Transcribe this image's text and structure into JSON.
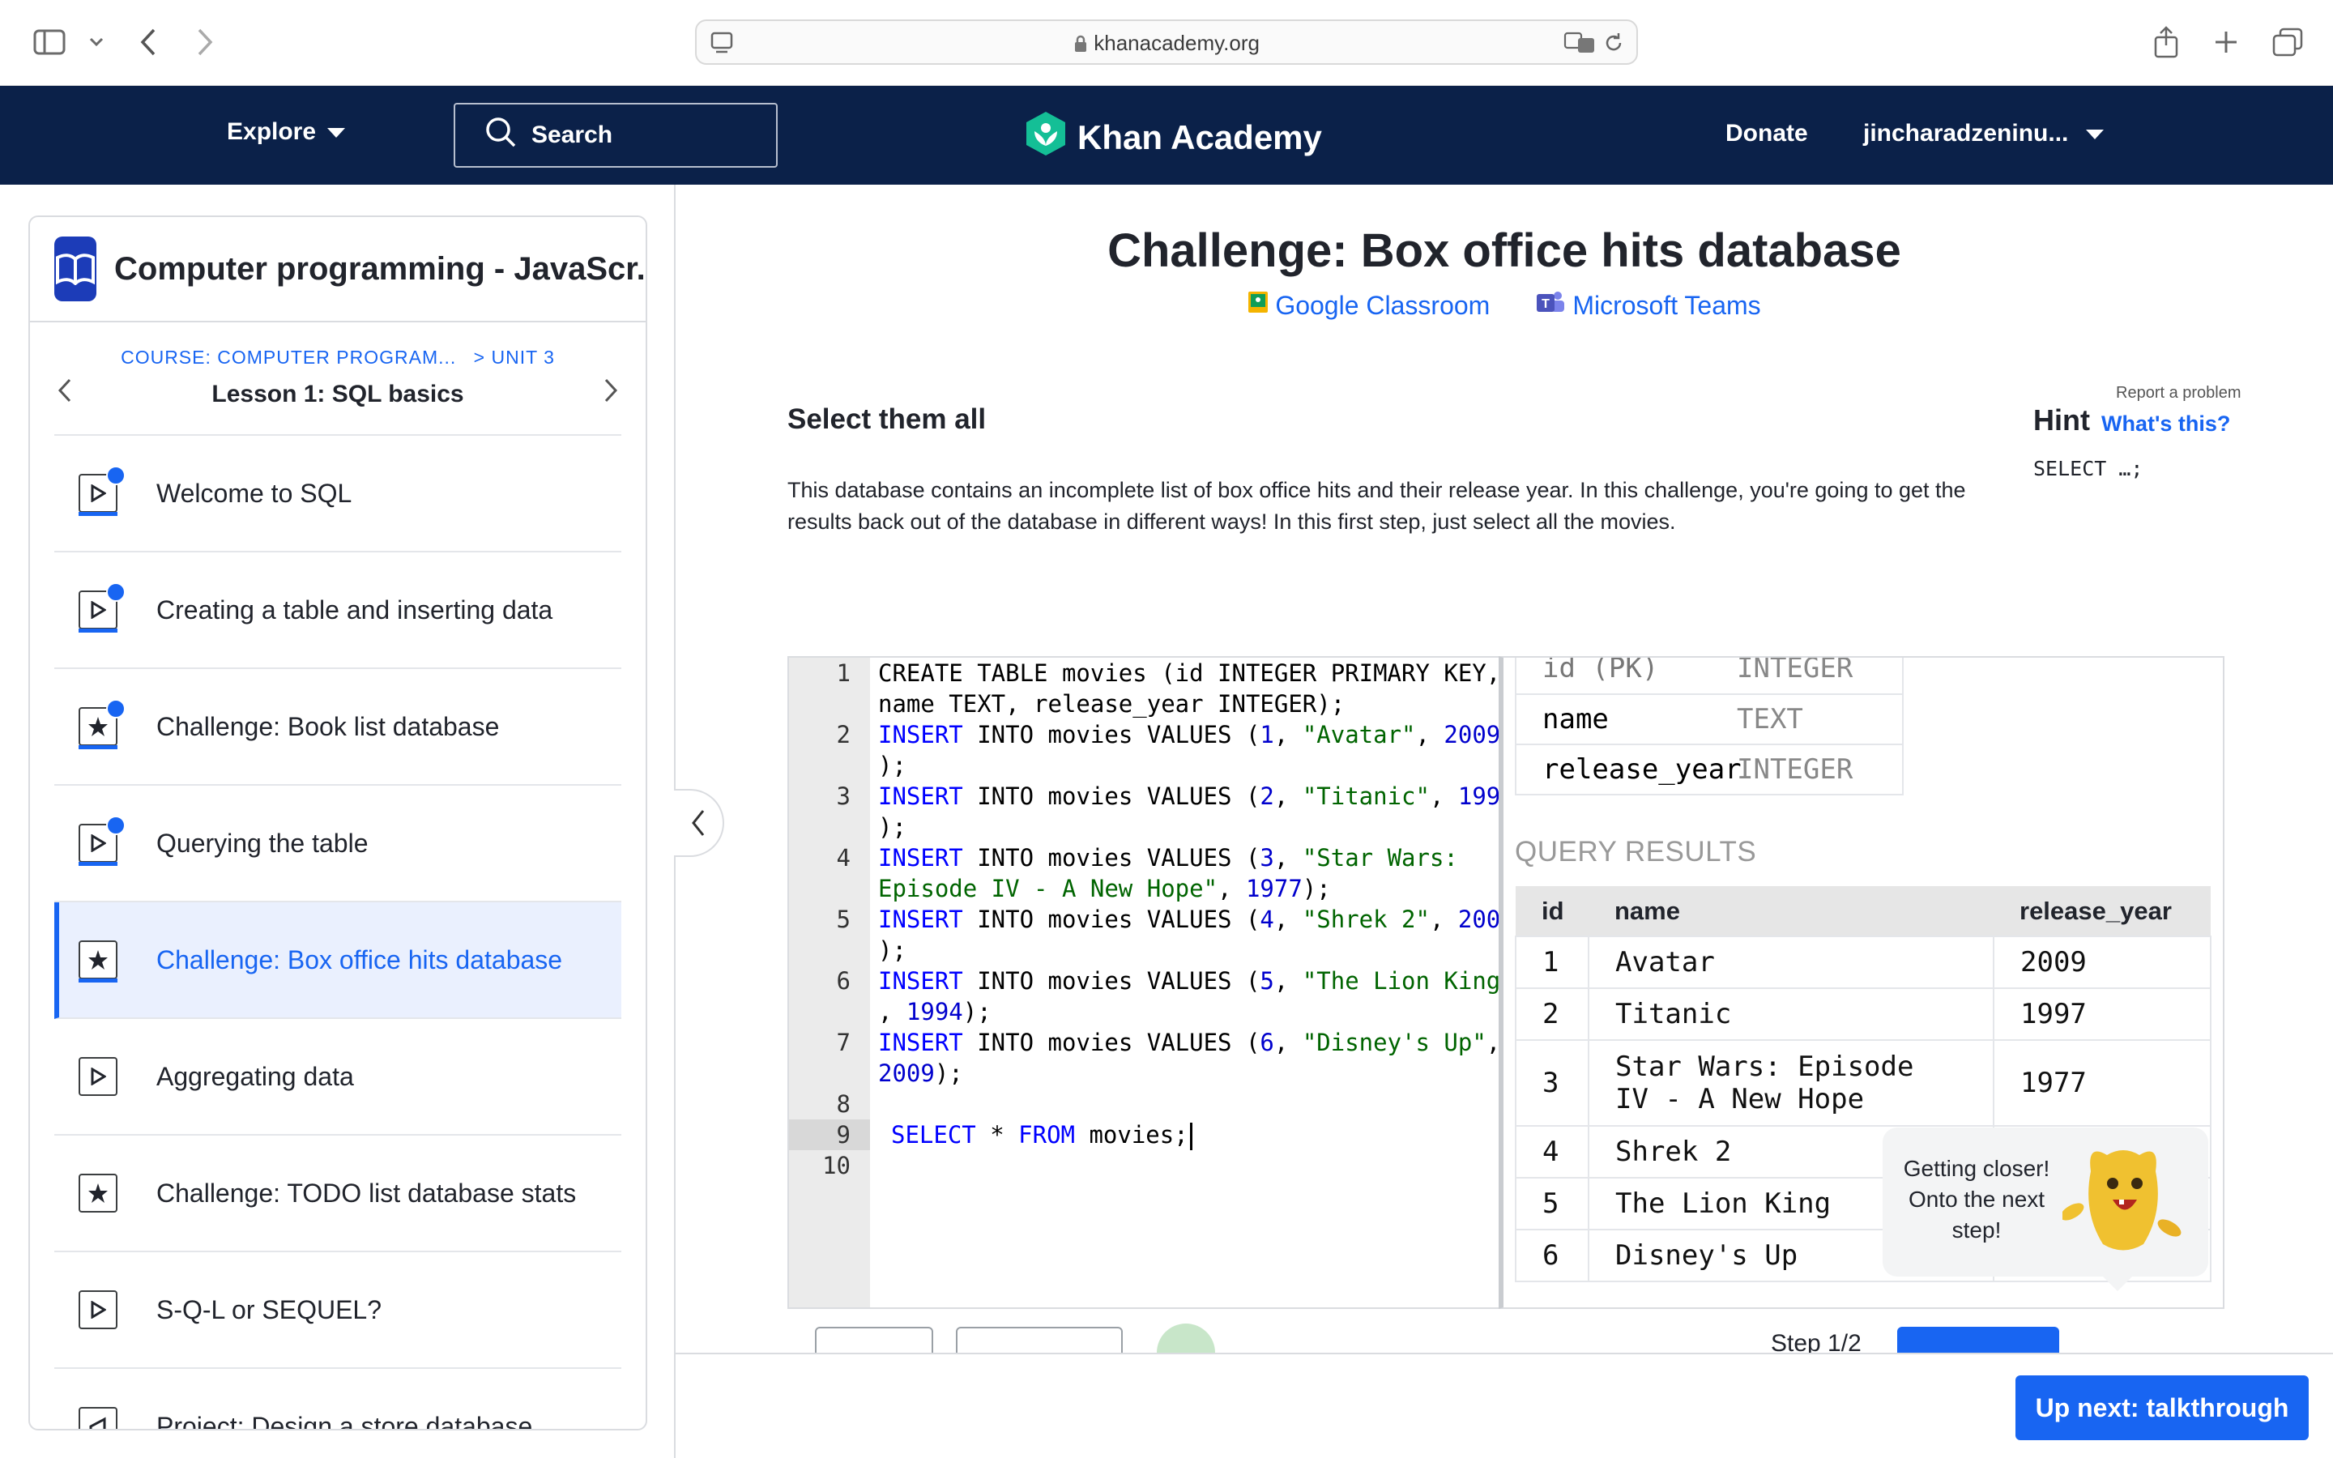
{
  "browser": {
    "url": "khanacademy.org"
  },
  "header": {
    "explore": "Explore",
    "search": "Search",
    "brand": "Khan Academy",
    "donate": "Donate",
    "user": "jincharadzeninu..."
  },
  "sidebar": {
    "course_title": "Computer programming - JavaScr...",
    "crumb_course": "COURSE: COMPUTER PROGRAM...",
    "crumb_unit": "> UNIT 3",
    "lesson_title": "Lesson 1: SQL basics",
    "items": [
      {
        "label": "Welcome to SQL",
        "icon": "video-icon",
        "done": true
      },
      {
        "label": "Creating a table and inserting data",
        "icon": "video-icon",
        "done": true
      },
      {
        "label": "Challenge: Book list database",
        "icon": "star-icon",
        "done": true
      },
      {
        "label": "Querying the table",
        "icon": "video-icon",
        "done": true
      },
      {
        "label": "Challenge: Box office hits database",
        "icon": "star-icon",
        "done": false,
        "active": true
      },
      {
        "label": "Aggregating data",
        "icon": "video-icon",
        "done": false
      },
      {
        "label": "Challenge: TODO list database stats",
        "icon": "star-icon",
        "done": false
      },
      {
        "label": "S-Q-L or SEQUEL?",
        "icon": "video-icon",
        "done": false
      },
      {
        "label": "Project: Design a store database",
        "icon": "project-icon",
        "done": false
      }
    ]
  },
  "main": {
    "title": "Challenge: Box office hits database",
    "google_classroom": "Google Classroom",
    "microsoft_teams": "Microsoft Teams",
    "step_title": "Select them all",
    "description": "This database contains an incomplete list of box office hits and their release year. In this challenge, you're going to get the results back out of the database in different ways! In this first step, just select all the movies.",
    "report": "Report a problem",
    "hint_label": "Hint",
    "whats_this": "What's this?",
    "hint_code": "SELECT …;",
    "step_counter": "Step 1/2",
    "up_next": "Up next: talkthrough"
  },
  "editor": {
    "line_numbers": [
      "1",
      "2",
      "3",
      "4",
      "5",
      "6",
      "7",
      "8",
      "9",
      "10"
    ],
    "current_line": 9
  },
  "schema": {
    "rows": [
      {
        "name": "id (PK)",
        "type": "INTEGER"
      },
      {
        "name": "name",
        "type": "TEXT"
      },
      {
        "name": "release_year",
        "type": "INTEGER"
      }
    ]
  },
  "results": {
    "label": "QUERY RESULTS",
    "headers": [
      "id",
      "name",
      "release_year"
    ],
    "rows": [
      [
        "1",
        "Avatar",
        "2009"
      ],
      [
        "2",
        "Titanic",
        "1997"
      ],
      [
        "3",
        "Star Wars: Episode IV - A New Hope",
        "1977"
      ],
      [
        "4",
        "Shrek 2",
        ""
      ],
      [
        "5",
        "The Lion King",
        ""
      ],
      [
        "6",
        "Disney's Up",
        ""
      ]
    ]
  },
  "tooltip": {
    "text": "Getting closer! Onto the next step!"
  },
  "colors": {
    "ka_navy": "#0b2149",
    "accent_blue": "#1865f2",
    "sql_keyword": "#0000ff",
    "sql_string": "#006400"
  }
}
